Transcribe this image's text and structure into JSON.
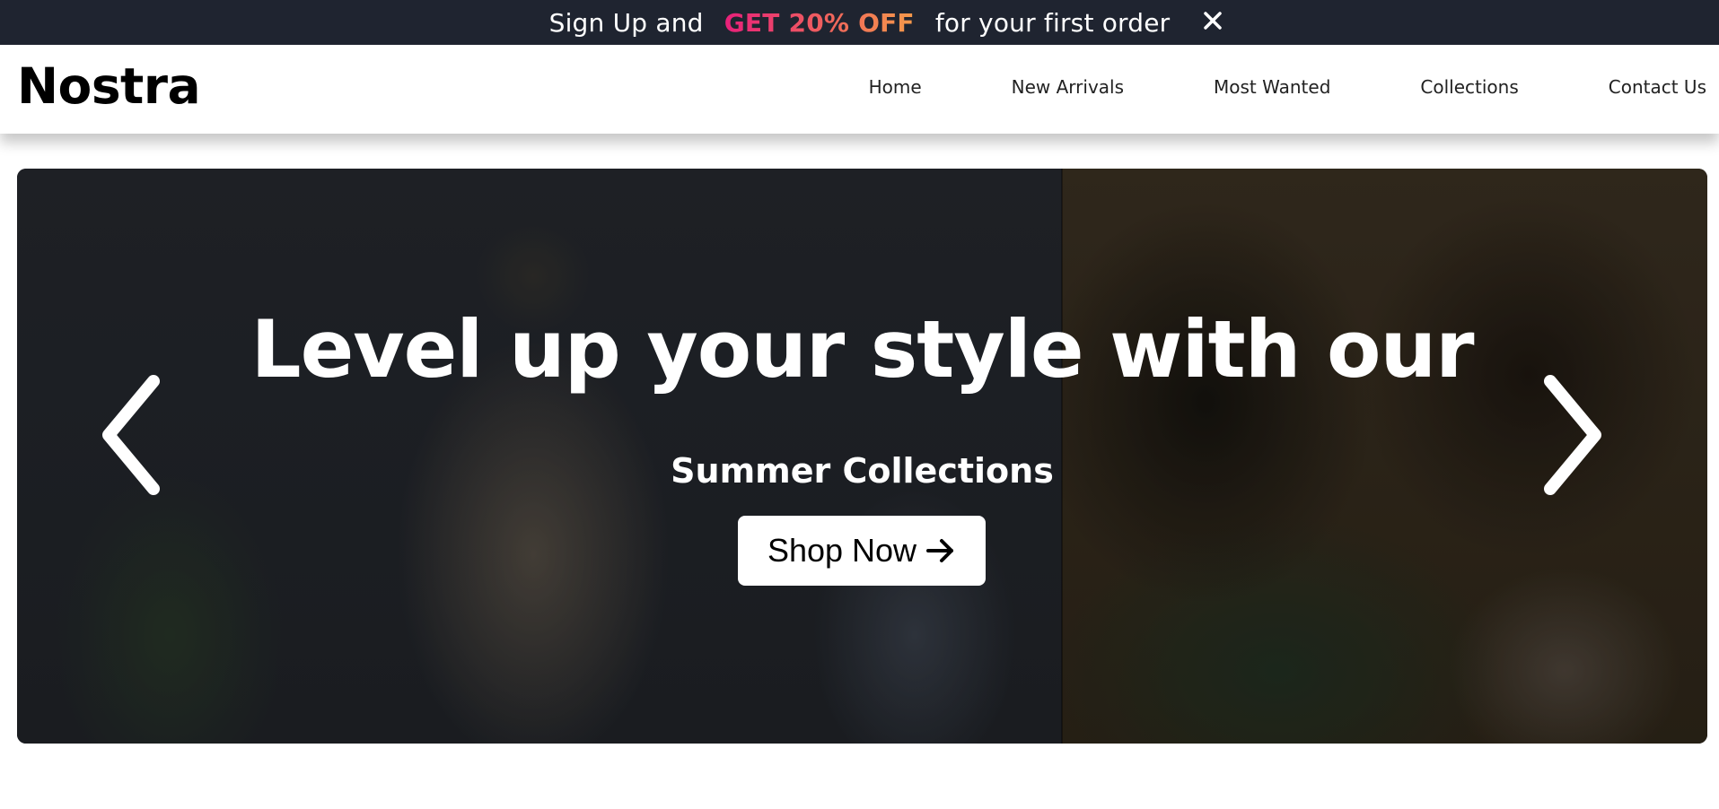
{
  "promo": {
    "text_before": "Sign Up and",
    "highlight": "GET 20% OFF",
    "text_after": "for your first order",
    "close_icon": "close-icon",
    "highlight_gradient": [
      "#e8207a",
      "#f59a4a"
    ]
  },
  "nav": {
    "logo": "Nostra",
    "links": [
      {
        "label": "Home"
      },
      {
        "label": "New Arrivals"
      },
      {
        "label": "Most Wanted"
      },
      {
        "label": "Collections"
      },
      {
        "label": "Contact Us"
      }
    ]
  },
  "hero": {
    "heading": "Level up your style with our",
    "subheading": "Summer Collections",
    "cta_label": "Shop Now",
    "cta_icon": "arrow-right-icon",
    "prev_icon": "chevron-left-icon",
    "next_icon": "chevron-right-icon"
  },
  "colors": {
    "promo_bg": "#1f2430",
    "text_dark": "#000000",
    "button_bg": "#ffffff"
  }
}
